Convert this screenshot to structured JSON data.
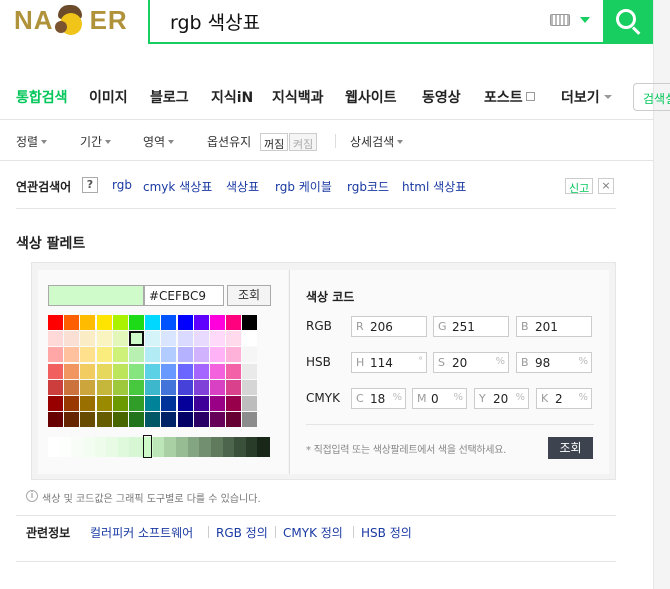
{
  "header": {
    "logo_left": "NA",
    "logo_right": "ER",
    "query": "rgb 색상표",
    "colors": {
      "accent": "#19ce60",
      "logo": "#b0923a"
    }
  },
  "tabs": [
    {
      "label": "통합검색",
      "active": true
    },
    {
      "label": "이미지"
    },
    {
      "label": "블로그"
    },
    {
      "label": "지식iN"
    },
    {
      "label": "지식백과"
    },
    {
      "label": "웹사이트"
    },
    {
      "label": "동영상"
    },
    {
      "label": "포스트"
    },
    {
      "label": "더보기"
    }
  ],
  "tab_button": "검색설",
  "options": {
    "sort": "정렬",
    "period": "기간",
    "area": "영역",
    "keep": "옵션유지",
    "keep_off": "꺼짐",
    "keep_on": "켜짐",
    "detail": "상세검색"
  },
  "related": {
    "title": "연관검색어",
    "help": "?",
    "links": [
      "rgb",
      "cmyk 색상표",
      "색상표",
      "rgb 케이블",
      "rgb코드",
      "html 색상표"
    ],
    "report": "신고",
    "close": "×"
  },
  "palette_section": {
    "title": "색상 팔레트",
    "hex_value": "#CEFBC9",
    "preview_color": "#CEFBC9",
    "lookup": "조회",
    "code_title": "색상 코드",
    "rgb": {
      "label": "RGB",
      "r": "206",
      "g": "251",
      "b": "201"
    },
    "hsb": {
      "label": "HSB",
      "h": "114",
      "s": "20",
      "b": "98"
    },
    "cmyk": {
      "label": "CMYK",
      "c": "18",
      "m": "0",
      "y": "20",
      "k": "2"
    },
    "tags": {
      "r": "R",
      "g": "G",
      "b": "B",
      "h": "H",
      "s": "S",
      "c": "C",
      "m": "M",
      "y": "Y",
      "k": "K"
    },
    "units": {
      "deg": "°",
      "pct": "%"
    },
    "note": "* 직접입력 또는 색상팔레트에서 색을 선택하세요.",
    "lookup_dark": "조회",
    "selected_cell": {
      "row": 1,
      "col": 5
    },
    "rows": [
      [
        "#ff0000",
        "#ff5e00",
        "#ffbb00",
        "#ffe400",
        "#abf200",
        "#1ddb16",
        "#00d8ff",
        "#0054ff",
        "#0100ff",
        "#5f00ff",
        "#ff00dd",
        "#ff007f",
        "#000000"
      ],
      [
        "#ffd8d8",
        "#fae0d4",
        "#faecc5",
        "#faf4c0",
        "#e4f7ba",
        "#cefbc9",
        "#d4f4fa",
        "#d9e5ff",
        "#dad9ff",
        "#e8d9ff",
        "#ffd9fa",
        "#ffd9ec",
        "#ffffff"
      ],
      [
        "#ffa7a7",
        "#ffc19e",
        "#ffe08c",
        "#faed7d",
        "#cef279",
        "#b7f0b1",
        "#b2ebf4",
        "#b2ccff",
        "#b5b2ff",
        "#d1b2ff",
        "#ffb2f5",
        "#ffb2d9",
        "#f6f6f6"
      ],
      [
        "#f15f5f",
        "#f29661",
        "#f2cb61",
        "#e5d85c",
        "#bce55c",
        "#86e57f",
        "#5cd1e5",
        "#6799ff",
        "#6b66ff",
        "#a566ff",
        "#f361dc",
        "#f361a6",
        "#eaeaea"
      ],
      [
        "#cc3d3d",
        "#cc723d",
        "#cca63d",
        "#c4b73b",
        "#9fc93c",
        "#47c83e",
        "#3db7cc",
        "#4374d9",
        "#4641d9",
        "#8041d9",
        "#d941c5",
        "#d9418c",
        "#d5d5d5"
      ],
      [
        "#980000",
        "#993800",
        "#997000",
        "#998a00",
        "#6b9900",
        "#2f9d27",
        "#008299",
        "#003399",
        "#050099",
        "#3f0099",
        "#990085",
        "#99004c",
        "#bdbdbd"
      ],
      [
        "#670000",
        "#662500",
        "#664b00",
        "#665c00",
        "#476600",
        "#22741c",
        "#005766",
        "#002266",
        "#030066",
        "#2a0066",
        "#660058",
        "#660033",
        "#8c8c8c"
      ]
    ],
    "gradient": [
      "#ffffff",
      "#fcfffc",
      "#f8fef7",
      "#f3fdf2",
      "#eefcec",
      "#e7fbe5",
      "#dff9dd",
      "#d7f7d4",
      "#cefbc9",
      "#bde6b8",
      "#a9cfa5",
      "#97bb93",
      "#84a581",
      "#728f70",
      "#5f7a5d",
      "#4d654c",
      "#3b503a",
      "#293b29",
      "#182718"
    ],
    "gradient_selected_index": 8,
    "info": "색상 및 코드값은 그래픽 도구별로 다를 수 있습니다."
  },
  "related_info": {
    "title": "관련정보",
    "links": [
      "컬러피커 소프트웨어",
      "RGB 정의",
      "CMYK 정의",
      "HSB 정의"
    ]
  }
}
